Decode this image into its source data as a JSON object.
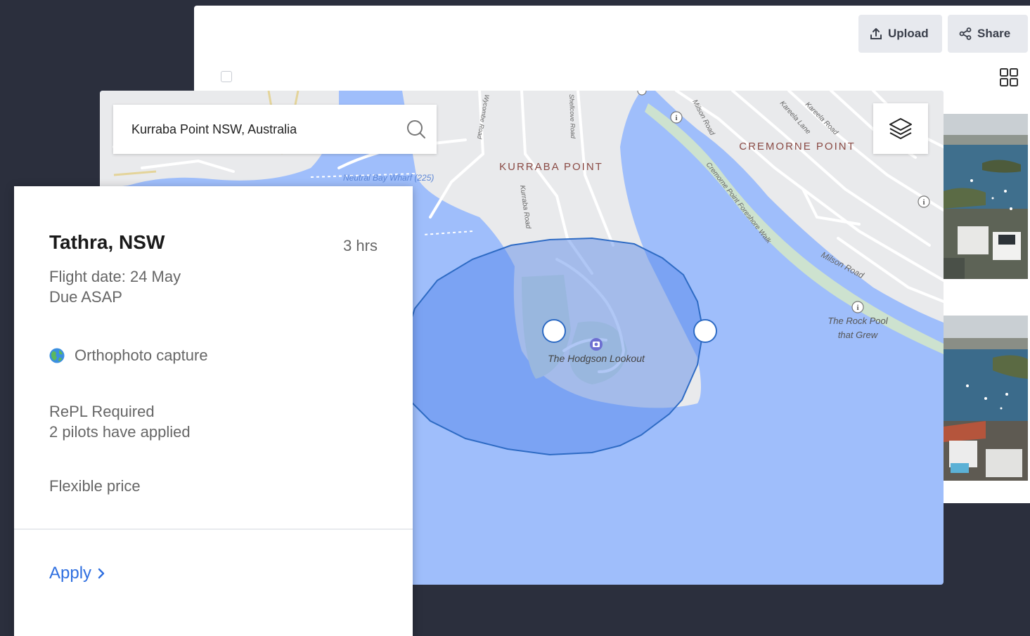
{
  "toolbar": {
    "upload_label": "Upload",
    "share_label": "Share"
  },
  "map": {
    "search_value": "Kurraba Point NSW, Australia",
    "places": {
      "kurraba_point": "KURRABA POINT",
      "cremorne_point": "CREMORNE POINT",
      "hodgson_lookout": "The Hodgson Lookout",
      "rock_pool_line1": "The Rock Pool",
      "rock_pool_line2": "that Grew",
      "neutral_bay_wharf": "Neutral Bay Wharf (225)"
    },
    "roads": {
      "kurraba_road": "Kurraba Road",
      "milson_road_upper": "Milson Road",
      "milson_road_lower": "Milson Road",
      "cremorne_walk": "Cremorne Point Foreshore Walk",
      "kareela_road": "Kareela Road",
      "kareela_lane": "Kareela Lane",
      "shellcove_road": "Shellcove Road",
      "wycombe_road": "Wycombe Road"
    }
  },
  "job": {
    "title": "Tathra, NSW",
    "duration": "3 hrs",
    "flight_date": "Flight date: 24 May",
    "due": "Due ASAP",
    "capture_type": "Orthophoto capture",
    "license": "RePL Required",
    "applicants": "2 pilots have applied",
    "price": "Flexible price",
    "apply_label": "Apply"
  },
  "colors": {
    "page_bg": "#2b2f3d",
    "water": "#9fbefb",
    "land": "#e9eaec",
    "accent_blue": "#2f6fe0",
    "zone_fill": "#7ea6f2",
    "zone_stroke": "#2e6bc4"
  }
}
